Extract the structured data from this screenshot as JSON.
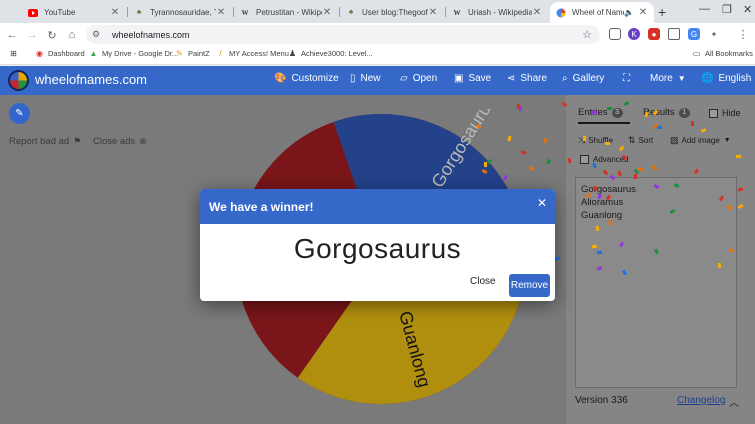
{
  "browser": {
    "tabs": [
      {
        "title": "YouTube",
        "icon": "youtube-icon"
      },
      {
        "title": "Tyrannosauridae, Tyra",
        "icon": "dino-icon"
      },
      {
        "title": "Petrustitan - Wikipedia",
        "icon": "wikipedia-icon"
      },
      {
        "title": "User blog:Thegoofyah",
        "icon": "dino-icon"
      },
      {
        "title": "Uriash - Wikipedia",
        "icon": "wikipedia-icon"
      },
      {
        "title": "Wheel of Names | ",
        "icon": "wheel-icon",
        "active": true
      }
    ],
    "url": "wheelofnames.com",
    "bookmarks": [
      {
        "label": "Dashboard",
        "icon": "dashboard-icon"
      },
      {
        "label": "My Drive - Google Dr...",
        "icon": "drive-icon"
      },
      {
        "label": "PaintZ",
        "icon": "paint-icon"
      },
      {
        "label": "MY Access! Menu",
        "icon": "pen-icon"
      },
      {
        "label": "Achieve3000: Level...",
        "icon": "achieve-icon"
      }
    ],
    "all_bookmarks": "All Bookmarks"
  },
  "site": {
    "brand": "wheelofnames.com",
    "nav": [
      "Customize",
      "New",
      "Open",
      "Save",
      "Share",
      "Gallery",
      "",
      "More",
      "English"
    ],
    "report_ad": "Report bad ad",
    "close_ads": "Close ads"
  },
  "wheel": {
    "segments": [
      {
        "label": "Gorgosaurus",
        "color": "#2a4a9a"
      },
      {
        "label": "Guanlong",
        "color": "#c4a010"
      },
      {
        "label": "Alioramus",
        "color": "#8a1820"
      }
    ]
  },
  "panel": {
    "tab_entries": "Entries",
    "entries_count": "3",
    "tab_results": "Results",
    "results_count": "1",
    "hide": "Hide",
    "shuffle": "Shuffle",
    "sort": "Sort",
    "add_image": "Add image",
    "advanced": "Advanced",
    "entries": [
      "Gorgosaurus",
      "Alioramus",
      "Guanlong"
    ],
    "version": "Version 336",
    "changelog": "Changelog"
  },
  "dialog": {
    "title": "We have a winner!",
    "winner": "Gorgosaurus",
    "close": "Close",
    "remove": "Remove"
  },
  "colors": {
    "accent": "#3568c9",
    "overlay": "#7a7a7a"
  }
}
